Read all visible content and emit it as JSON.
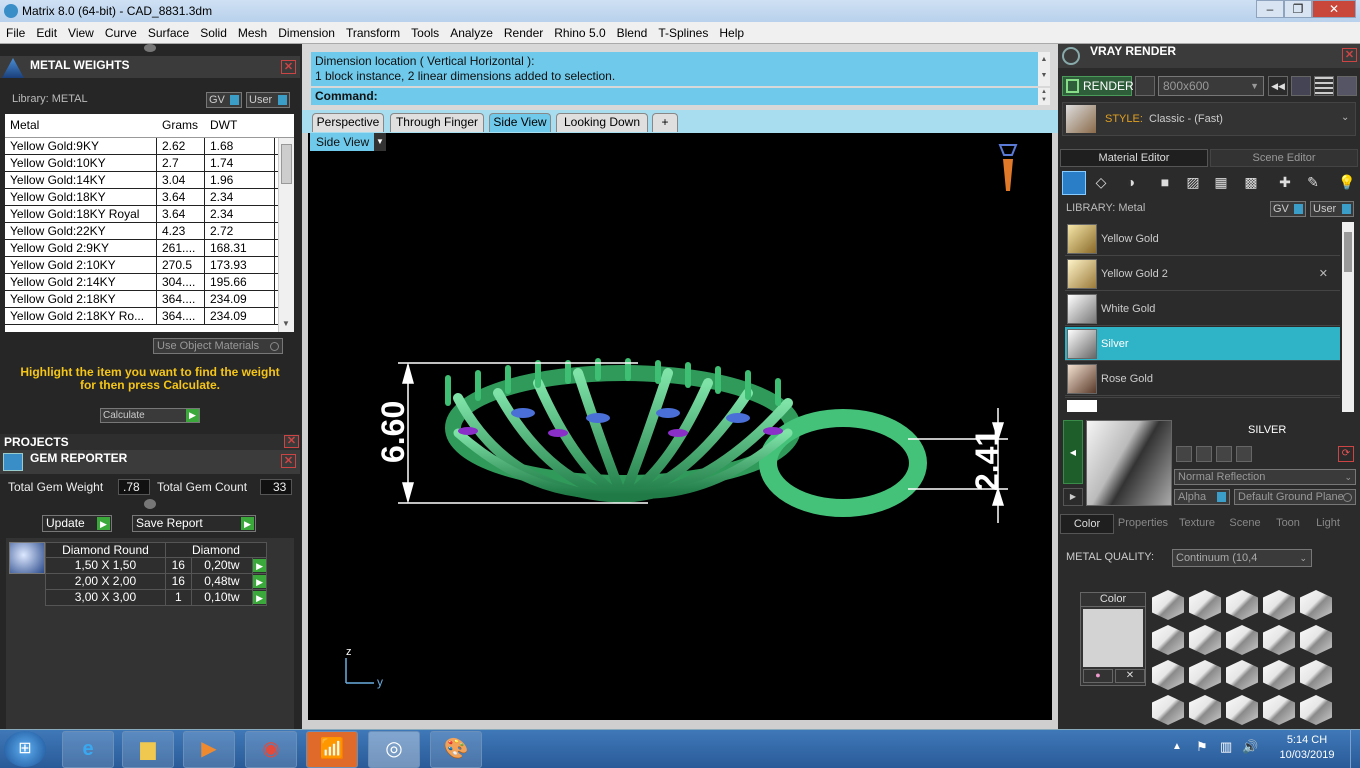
{
  "title": "Matrix 8.0 (64-bit) - CAD_8831.3dm",
  "menu": [
    "File",
    "Edit",
    "View",
    "Curve",
    "Surface",
    "Solid",
    "Mesh",
    "Dimension",
    "Transform",
    "Tools",
    "Analyze",
    "Render",
    "Rhino 5.0",
    "Blend",
    "T-Splines",
    "Help"
  ],
  "metal": {
    "title": "METAL WEIGHTS",
    "library": "Library: METAL",
    "gv": "GV",
    "user": "User",
    "headers": [
      "Metal",
      "Grams",
      "DWT"
    ],
    "rows": [
      [
        "Yellow Gold:9KY",
        "2.62",
        "1.68"
      ],
      [
        "Yellow Gold:10KY",
        "2.7",
        "1.74"
      ],
      [
        "Yellow Gold:14KY",
        "3.04",
        "1.96"
      ],
      [
        "Yellow Gold:18KY",
        "3.64",
        "2.34"
      ],
      [
        "Yellow Gold:18KY Royal",
        "3.64",
        "2.34"
      ],
      [
        "Yellow Gold:22KY",
        "4.23",
        "2.72"
      ],
      [
        "Yellow Gold 2:9KY",
        "261....",
        "168.31"
      ],
      [
        "Yellow Gold 2:10KY",
        "270.5",
        "173.93"
      ],
      [
        "Yellow Gold 2:14KY",
        "304....",
        "195.66"
      ],
      [
        "Yellow Gold 2:18KY",
        "364....",
        "234.09"
      ],
      [
        "Yellow Gold 2:18KY Ro...",
        "364....",
        "234.09"
      ]
    ],
    "use_obj": "Use Object Materials",
    "hint": "Highlight the item you want to find the weight for then press Calculate.",
    "calc": "Calculate"
  },
  "projects": "PROJECTS",
  "gem": {
    "title": "GEM REPORTER",
    "total_weight_label": "Total Gem Weight",
    "total_weight": ".78",
    "total_count_label": "Total Gem Count",
    "total_count": "33",
    "update": "Update",
    "save": "Save Report",
    "headers": [
      "Diamond Round",
      "Diamond"
    ],
    "rows": [
      [
        "1,50 X 1,50",
        "16",
        "0,20tw"
      ],
      [
        "2,00 X 2,00",
        "16",
        "0,48tw"
      ],
      [
        "3,00 X 3,00",
        "1",
        "0,10tw"
      ]
    ]
  },
  "cmd": {
    "line1": "Dimension location ( Vertical  Horizontal ):",
    "line2": "1 block instance, 2 linear dimensions added to selection.",
    "prompt": "Command:"
  },
  "tabs": [
    "Perspective",
    "Through Finger",
    "Side View",
    "Looking Down",
    "+"
  ],
  "viewport": {
    "label": "Side View",
    "dim1": "6.60",
    "dim2": "2.41",
    "axis_z": "z",
    "axis_y": "y"
  },
  "vray": {
    "title": "VRAY RENDER",
    "render": "RENDER",
    "resolution": "800x600",
    "style_label": "STYLE:",
    "style": "Classic - (Fast)",
    "tab1": "Material Editor",
    "tab2": "Scene Editor",
    "library": "LIBRARY: Metal",
    "gv": "GV",
    "user": "User",
    "materials": [
      "Yellow Gold",
      "Yellow Gold 2",
      "White Gold",
      "Silver",
      "Rose Gold"
    ],
    "selected": "SILVER",
    "reflection": "Normal Reflection",
    "alpha": "Alpha",
    "ground": "Default Ground Plane",
    "subtabs": [
      "Color",
      "Properties",
      "Texture",
      "Scene",
      "Toon",
      "Light"
    ],
    "quality_label": "METAL QUALITY:",
    "quality": "Continuum (10,4",
    "color_label": "Color"
  },
  "taskbar": {
    "time": "5:14 CH",
    "date": "10/03/2019"
  }
}
